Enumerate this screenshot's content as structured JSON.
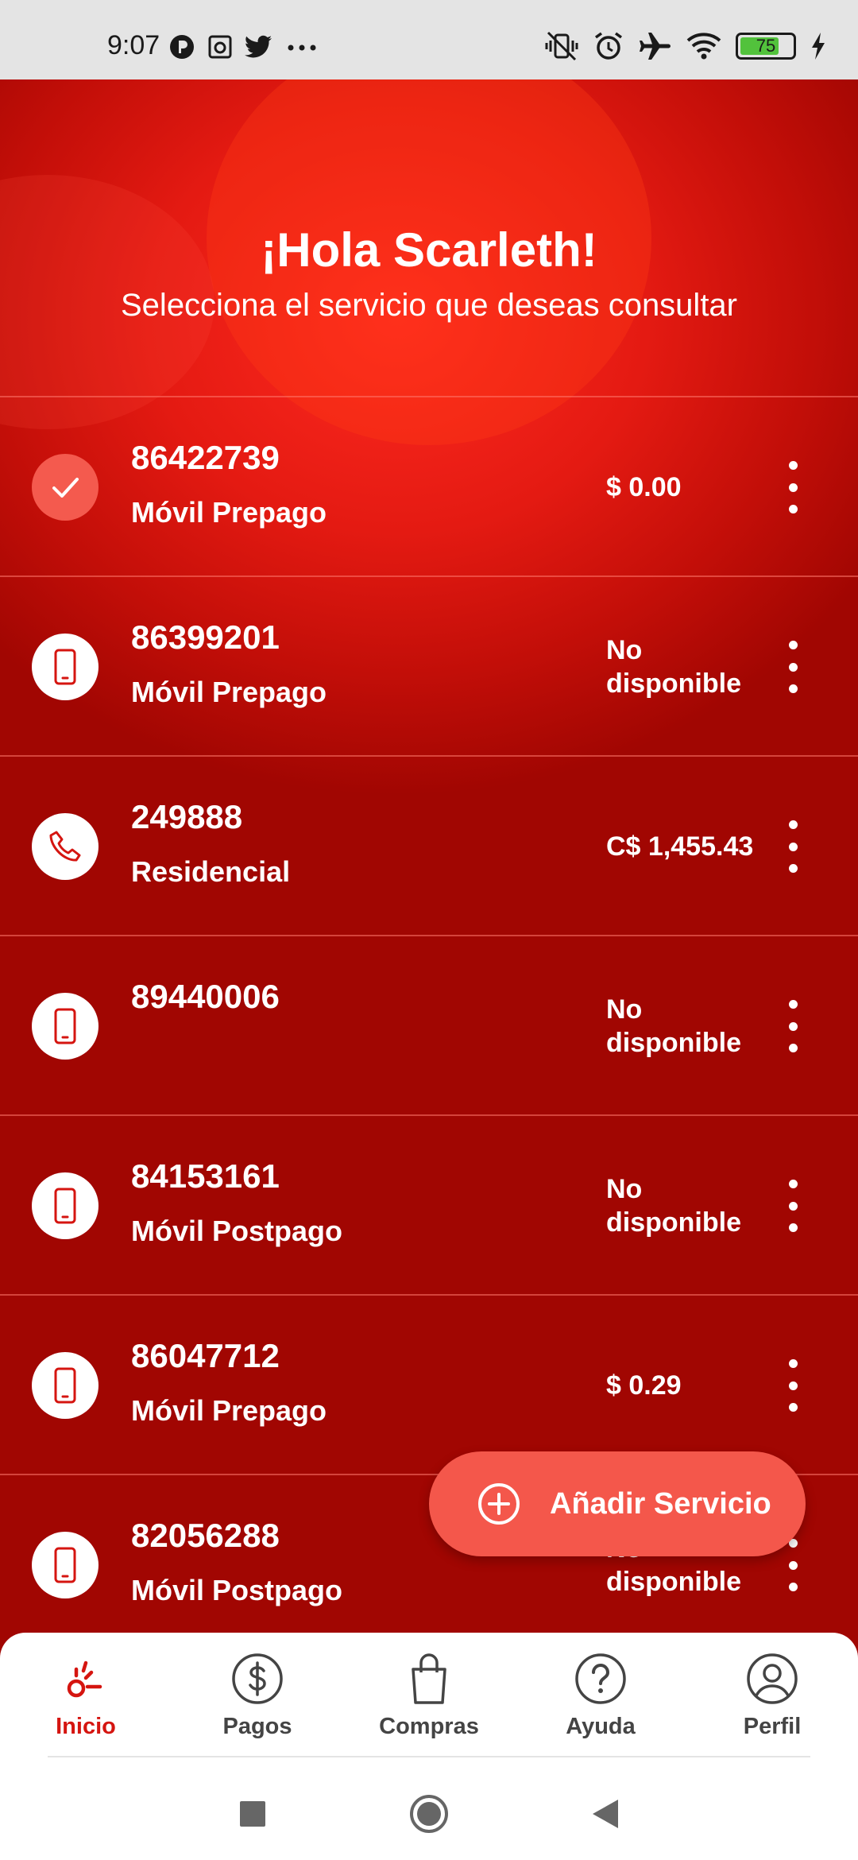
{
  "status_bar": {
    "time": "9:07",
    "battery": "75",
    "icons": [
      "p-icon",
      "camera-icon",
      "twitter-icon",
      "more-dots-icon",
      "vibrate-icon",
      "alarm-icon",
      "airplane-icon",
      "wifi-icon",
      "battery-icon",
      "charging-icon"
    ]
  },
  "header": {
    "greeting": "¡Hola Scarleth!",
    "subtitle": "Selecciona el servicio que deseas consultar"
  },
  "services": [
    {
      "number": "86422739",
      "type": "Móvil Prepago",
      "balance": "$ 0.00",
      "icon": "check-icon",
      "selected": true
    },
    {
      "number": "86399201",
      "type": "Móvil Prepago",
      "balance": "No disponible",
      "icon": "mobile-phone-icon",
      "selected": false
    },
    {
      "number": "249888",
      "type": "Residencial",
      "balance": "C$ 1,455.43",
      "icon": "landline-phone-icon",
      "selected": false
    },
    {
      "number": "89440006",
      "type": "",
      "balance": "No disponible",
      "icon": "mobile-phone-icon",
      "selected": false
    },
    {
      "number": "84153161",
      "type": "Móvil Postpago",
      "balance": "No disponible",
      "icon": "mobile-phone-icon",
      "selected": false
    },
    {
      "number": "86047712",
      "type": "Móvil Prepago",
      "balance": "$ 0.29",
      "icon": "mobile-phone-icon",
      "selected": false
    },
    {
      "number": "82056288",
      "type": "Móvil Postpago",
      "balance": "No disponible",
      "icon": "mobile-phone-icon",
      "selected": false
    }
  ],
  "fab": {
    "label": "Añadir Servicio",
    "icon": "plus-circle-icon"
  },
  "bottom_nav": [
    {
      "label": "Inicio",
      "icon": "home-icon",
      "active": true
    },
    {
      "label": "Pagos",
      "icon": "dollar-circle-icon",
      "active": false
    },
    {
      "label": "Compras",
      "icon": "shopping-bag-icon",
      "active": false
    },
    {
      "label": "Ayuda",
      "icon": "help-circle-icon",
      "active": false
    },
    {
      "label": "Perfil",
      "icon": "profile-icon",
      "active": false
    }
  ],
  "colors": {
    "primary_red": "#d51510",
    "fab": "#f4574b",
    "selected_check": "#f45a4e"
  }
}
